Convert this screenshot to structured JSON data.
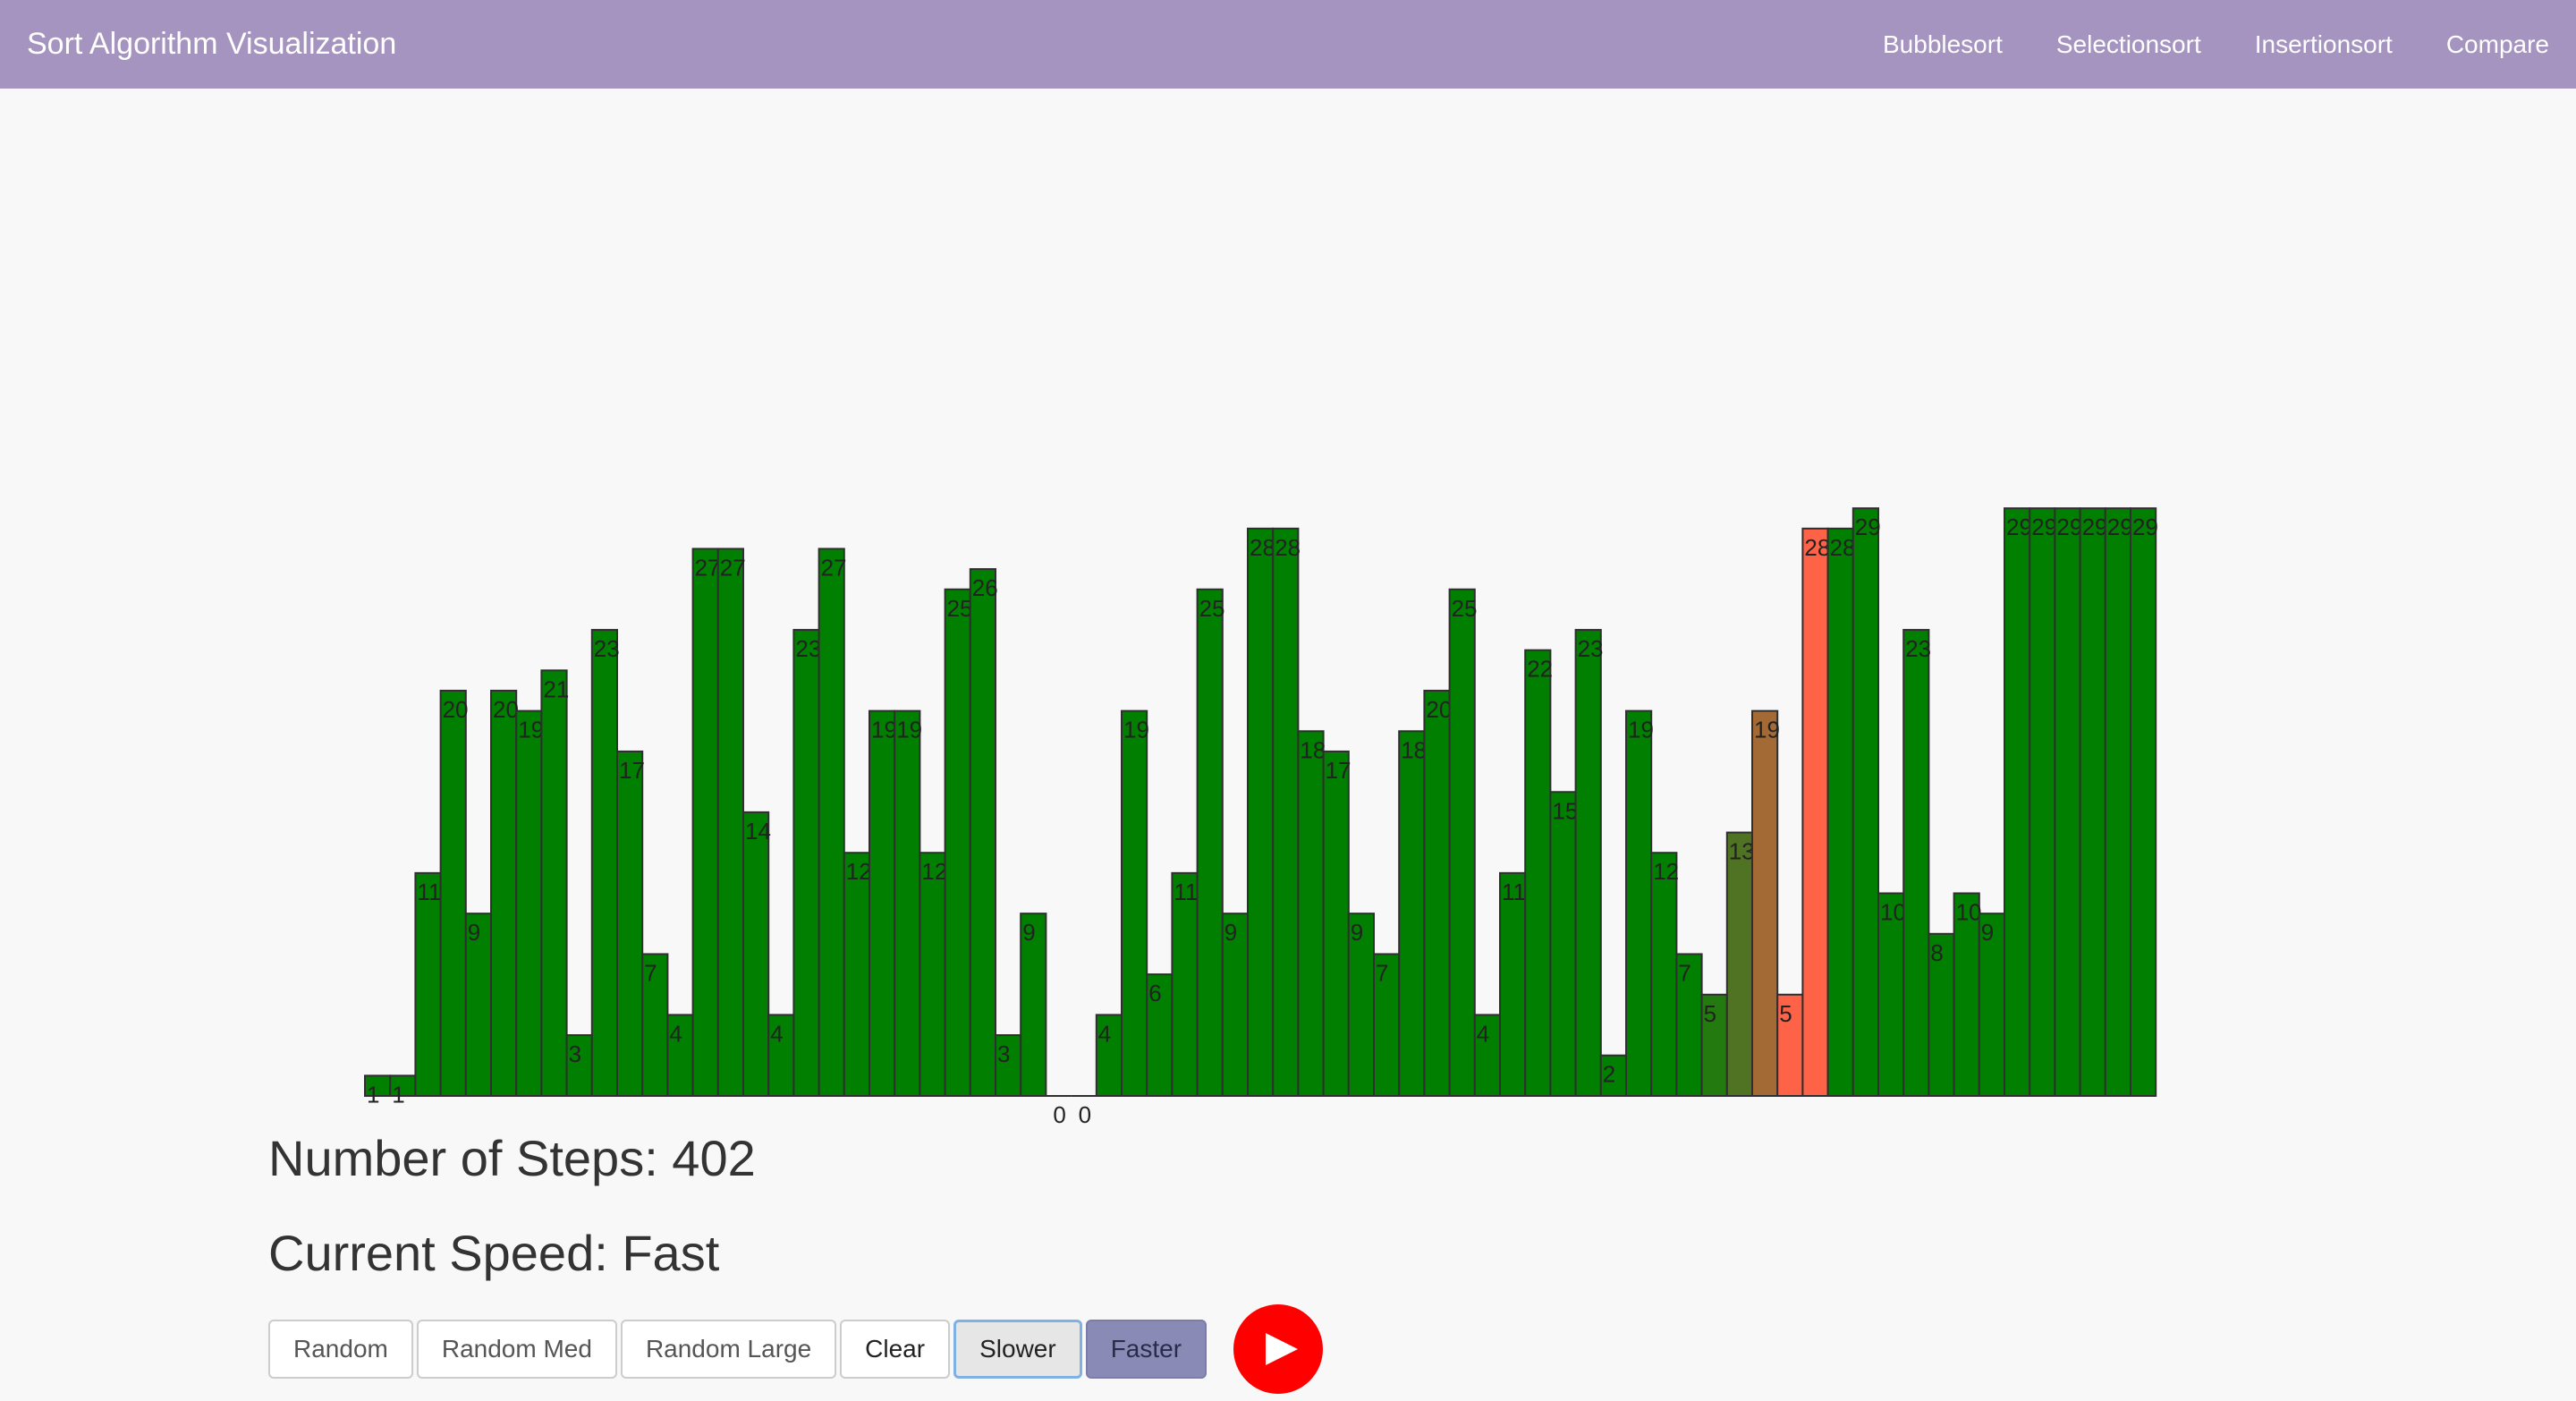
{
  "navbar": {
    "brand": "Sort Algorithm Visualization",
    "links": [
      "Bubblesort",
      "Selectionsort",
      "Insertionsort",
      "Compare"
    ],
    "color": "#a594bf"
  },
  "stats": {
    "steps": "Number of Steps: 402",
    "speed": "Current Speed: Fast"
  },
  "buttons": {
    "random": "Random",
    "random_med": "Random Med",
    "random_large": "Random Large",
    "clear": "Clear",
    "slower": "Slower",
    "faster": "Faster",
    "play_icon": "play-icon"
  },
  "chart_data": {
    "type": "bar",
    "values": [
      1,
      1,
      11,
      20,
      9,
      20,
      19,
      21,
      3,
      23,
      17,
      7,
      4,
      27,
      27,
      14,
      4,
      23,
      27,
      12,
      19,
      19,
      12,
      25,
      26,
      3,
      9,
      0,
      0,
      4,
      19,
      6,
      11,
      25,
      9,
      28,
      28,
      18,
      17,
      9,
      7,
      18,
      20,
      25,
      4,
      11,
      22,
      15,
      23,
      2,
      19,
      12,
      7,
      5,
      13,
      19,
      5,
      28,
      28,
      29,
      10,
      23,
      8,
      10,
      9,
      29,
      29,
      29,
      29,
      29,
      29
    ],
    "bar_colors": [
      "#007f00",
      "#007f00",
      "#007f00",
      "#007f00",
      "#007f00",
      "#007f00",
      "#007f00",
      "#007f00",
      "#007f00",
      "#007f00",
      "#007f00",
      "#007f00",
      "#007f00",
      "#007f00",
      "#007f00",
      "#007f00",
      "#007f00",
      "#007f00",
      "#007f00",
      "#007f00",
      "#007f00",
      "#007f00",
      "#007f00",
      "#007f00",
      "#007f00",
      "#007f00",
      "#007f00",
      "#007f00",
      "#007f00",
      "#007f00",
      "#007f00",
      "#007f00",
      "#007f00",
      "#007f00",
      "#007f00",
      "#007f00",
      "#007f00",
      "#007f00",
      "#007f00",
      "#007f00",
      "#007f00",
      "#007f00",
      "#007f00",
      "#007f00",
      "#007f00",
      "#007f00",
      "#007f00",
      "#007f00",
      "#007f00",
      "#007f00",
      "#007f00",
      "#007f00",
      "#007f00",
      "#237a0e",
      "#4f7322",
      "#a36a35",
      "#ff6347",
      "#ff6347",
      "#007f00",
      "#007f00",
      "#007f00",
      "#007f00",
      "#007f00",
      "#007f00",
      "#007f00",
      "#007f00",
      "#007f00",
      "#007f00",
      "#007f00",
      "#007f00",
      "#007f00"
    ],
    "ylim": [
      0,
      29
    ],
    "zero_labels": [
      "0",
      "0"
    ]
  }
}
